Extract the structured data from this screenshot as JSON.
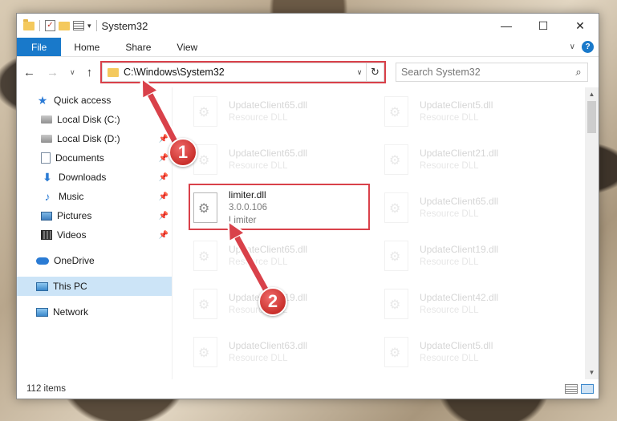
{
  "title_bar": {
    "title": "System32",
    "minimize": "—",
    "maximize": "☐",
    "close": "✕"
  },
  "ribbon": {
    "tabs": [
      "File",
      "Home",
      "Share",
      "View"
    ],
    "expand": "∨",
    "help": "?"
  },
  "address_bar": {
    "path": "C:\\Windows\\System32",
    "dropdown": "∨",
    "refresh": "↻"
  },
  "search": {
    "placeholder": "Search System32",
    "icon": "search-icon"
  },
  "navigation": {
    "back": "←",
    "forward": "→",
    "recent": "∨",
    "up": "↑"
  },
  "nav_pane": {
    "items": [
      {
        "label": "Quick access",
        "icon": "star-icon"
      },
      {
        "label": "Local Disk (C:)",
        "icon": "disk-icon"
      },
      {
        "label": "Local Disk (D:)",
        "icon": "disk-icon",
        "pinned": "pin-icon"
      },
      {
        "label": "Documents",
        "icon": "documents-icon",
        "pinned": "pin-icon"
      },
      {
        "label": "Downloads",
        "icon": "downloads-icon",
        "pinned": "pin-icon"
      },
      {
        "label": "Music",
        "icon": "music-icon",
        "pinned": "pin-icon"
      },
      {
        "label": "Pictures",
        "icon": "pictures-icon",
        "pinned": "pin-icon"
      },
      {
        "label": "Videos",
        "icon": "videos-icon",
        "pinned": "pin-icon"
      },
      {
        "label": "OneDrive",
        "icon": "onedrive-icon"
      },
      {
        "label": "This PC",
        "icon": "this-pc-icon",
        "selected": true
      },
      {
        "label": "Network",
        "icon": "network-icon"
      }
    ]
  },
  "files": [
    {
      "name": "UpdateClient65.dll",
      "type": "Resource DLL"
    },
    {
      "name": "UpdateClient5.dll",
      "type": "Resource DLL"
    },
    {
      "name": "UpdateClient65.dll",
      "type": "Resource DLL"
    },
    {
      "name": "UpdateClient21.dll",
      "type": "Resource DLL"
    },
    {
      "name": "limiter.dll",
      "version": "3.0.0.106",
      "type": "Limiter",
      "highlighted": true
    },
    {
      "name": "UpdateClient65.dll",
      "type": "Resource DLL"
    },
    {
      "name": "UpdateClient65.dll",
      "type": "Resource DLL"
    },
    {
      "name": "UpdateClient19.dll",
      "type": "Resource DLL"
    },
    {
      "name": "UpdateClient19.dll",
      "type": "Resource DLL"
    },
    {
      "name": "UpdateClient42.dll",
      "type": "Resource DLL"
    },
    {
      "name": "UpdateClient63.dll",
      "type": "Resource DLL"
    },
    {
      "name": "UpdateClient5.dll",
      "type": "Resource DLL"
    }
  ],
  "status_bar": {
    "item_count": "112 items"
  },
  "annotations": {
    "step1": "1",
    "step2": "2",
    "color": "#d9414a"
  }
}
